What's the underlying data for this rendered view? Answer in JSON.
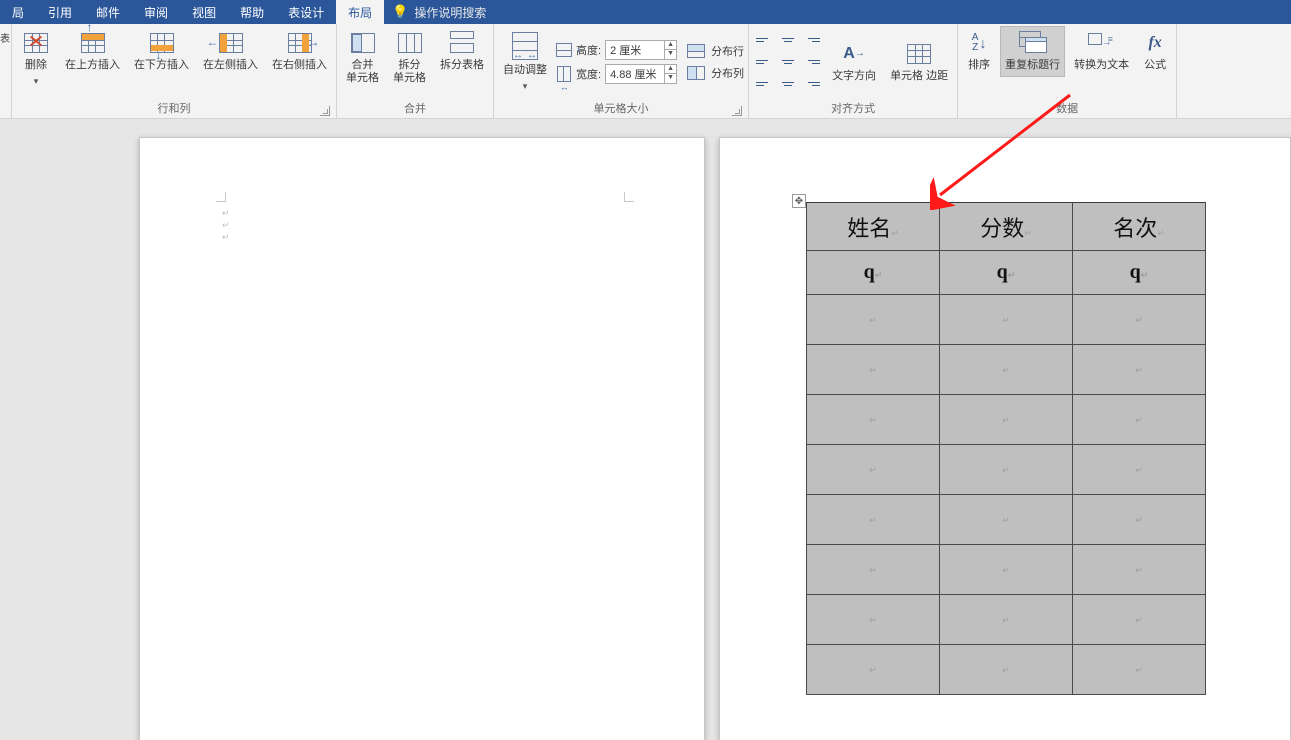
{
  "menu": {
    "tabs": [
      "局",
      "引用",
      "邮件",
      "审阅",
      "视图",
      "帮助",
      "表设计",
      "布局"
    ],
    "active_index": 7,
    "search_placeholder": "操作说明搜索"
  },
  "ribbon": {
    "leftcut": "表",
    "rows_cols": {
      "label": "行和列",
      "delete": "删除",
      "insert_above": "在上方插入",
      "insert_below": "在下方插入",
      "insert_left": "在左侧插入",
      "insert_right": "在右侧插入"
    },
    "merge": {
      "label": "合并",
      "merge_cells": "合并\n单元格",
      "split_cells": "拆分\n单元格",
      "split_table": "拆分表格"
    },
    "autosize": {
      "label": "单元格大小",
      "auto_adjust": "自动调整",
      "height_label": "高度:",
      "height_value": "2 厘米",
      "width_label": "宽度:",
      "width_value": "4.88 厘米",
      "distribute_rows": "分布行",
      "distribute_cols": "分布列"
    },
    "align": {
      "label": "对齐方式",
      "text_direction": "文字方向",
      "cell_margins": "单元格\n边距"
    },
    "data": {
      "label": "数据",
      "sort": "排序",
      "repeat_header": "重复标题行",
      "to_text": "转换为文本",
      "formula": "公式"
    }
  },
  "table": {
    "headers": [
      "姓名",
      "分数",
      "名次"
    ],
    "subrow": [
      "q",
      "q",
      "q"
    ],
    "blank_rows": 8
  }
}
